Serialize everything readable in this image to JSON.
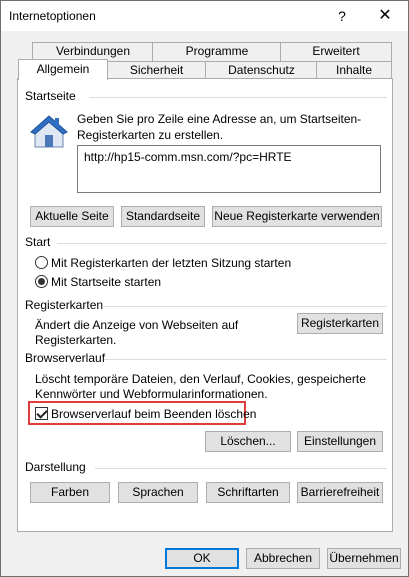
{
  "window": {
    "title": "Internetoptionen",
    "help_icon": "?",
    "close_icon": "✕"
  },
  "tabs": {
    "row1": [
      "Verbindungen",
      "Programme",
      "Erweitert"
    ],
    "row2": [
      "Allgemein",
      "Sicherheit",
      "Datenschutz",
      "Inhalte"
    ],
    "active": "Allgemein"
  },
  "startseite": {
    "title": "Startseite",
    "description_line1": "Geben Sie pro Zeile eine Adresse an, um Startseiten-",
    "description_line2": "Registerkarten zu erstellen.",
    "url": "http://hp15-comm.msn.com/?pc=HRTE",
    "buttons": [
      "Aktuelle Seite",
      "Standardseite",
      "Neue Registerkarte verwenden"
    ],
    "icon": "house-icon"
  },
  "start": {
    "title": "Start",
    "options": [
      {
        "label": "Mit Registerkarten der letzten Sitzung starten",
        "checked": false
      },
      {
        "label": "Mit Startseite starten",
        "checked": true
      }
    ]
  },
  "registerkarten": {
    "title": "Registerkarten",
    "description_line1": "Ändert die Anzeige von Webseiten auf",
    "description_line2": "Registerkarten.",
    "button": "Registerkarten"
  },
  "browserverlauf": {
    "title": "Browserverlauf",
    "description_line1": "Löscht temporäre Dateien, den Verlauf, Cookies, gespeicherte",
    "description_line2": "Kennwörter und Webformularinformationen.",
    "checkbox_label": "Browserverlauf beim Beenden löschen",
    "checkbox_checked": true,
    "buttons": [
      "Löschen...",
      "Einstellungen"
    ]
  },
  "darstellung": {
    "title": "Darstellung",
    "buttons": [
      "Farben",
      "Sprachen",
      "Schriftarten",
      "Barrierefreiheit"
    ]
  },
  "footer": {
    "ok": "OK",
    "cancel": "Abbrechen",
    "apply": "Übernehmen"
  }
}
